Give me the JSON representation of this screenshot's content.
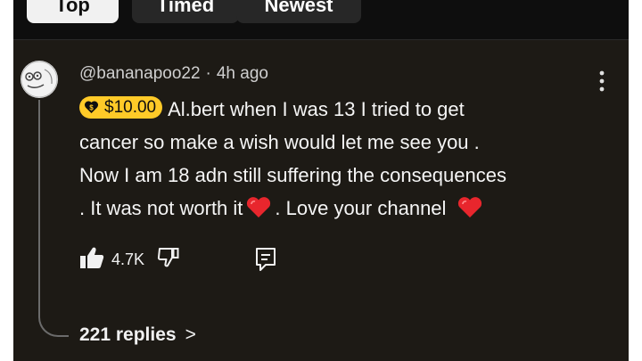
{
  "tabs": [
    {
      "label": "Top",
      "selected": true
    },
    {
      "label": "Timed",
      "selected": false
    },
    {
      "label": "Newest",
      "selected": false
    }
  ],
  "comment": {
    "author": "@bananapoo22",
    "separator": "·",
    "time": "4h ago",
    "super_thanks_amount": "$10.00",
    "text_line1": "Al.bert when I was 13 I tried to get",
    "text_line2": "cancer so make a wish would let me see you .",
    "text_line3": "Now I am 18 adn still suffering the consequences",
    "text_line4a": ". It was not worth it",
    "text_line4b": ".  Love your channel",
    "like_count": "4.7K",
    "replies_label": "221 replies",
    "replies_chevron": ">"
  },
  "icons": {
    "more": "more-vert-icon",
    "like": "thumbs-up-icon",
    "dislike": "thumbs-down-icon",
    "reply": "reply-comment-icon",
    "heart": "red-heart-emoji",
    "super_thanks": "dollar-heart-icon"
  },
  "colors": {
    "panel_bg": "#1d1a15",
    "badge_bg": "#ffca28",
    "heart": "#e8262d",
    "text": "#f5f5f5",
    "meta_text": "#cfcfcf"
  }
}
